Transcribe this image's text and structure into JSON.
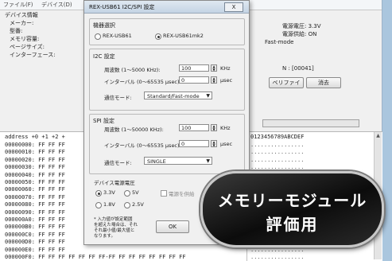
{
  "menubar": {
    "items": [
      "ファイル(F)",
      "デバイス(D)"
    ]
  },
  "device_info": {
    "heading": "デバイス情報",
    "rows": [
      "メーカー:",
      "型番:",
      "メモリ容量:",
      "ページサイズ:",
      "インターフェース:"
    ]
  },
  "right_info": {
    "voltage": "電源電圧: 3.3V",
    "power_supply": "電源供給: ON",
    "mode": "Fast-mode",
    "n_label": "N : [00041]"
  },
  "main_buttons": {
    "verify": "ベリファイ",
    "erase": "消去"
  },
  "dialog": {
    "title": "REX-USB61 I2C/SPI 設定",
    "close": "X",
    "model_group": {
      "title": "機器選択",
      "options": [
        "REX-USB61",
        "REX-USB61mk2"
      ],
      "selected": 1
    },
    "i2c_group": {
      "title": "I2C 設定",
      "freq_label": "周波数 (1〜5000 KHz):",
      "freq_value": "100",
      "freq_unit": "KHz",
      "interval_label": "インターバル (0〜65535 μsec):",
      "interval_value": "0",
      "interval_unit": "μsec",
      "mode_label": "通信モード:",
      "mode_value": "Standard/Fast-mode"
    },
    "spi_group": {
      "title": "SPI 設定",
      "freq_label": "周波数 (1〜50000 KHz):",
      "freq_value": "100",
      "freq_unit": "KHz",
      "interval_label": "インターバル (0〜65535 μsec):",
      "interval_value": "0",
      "interval_unit": "μsec",
      "mode_label": "通信モード:",
      "mode_value": "SINGLE"
    },
    "power_group": {
      "title": "デバイス電源電圧",
      "options": [
        "3.3V",
        "5V",
        "1.8V",
        "2.5V"
      ],
      "selected": 0,
      "supply_check": "電源を供給"
    },
    "note": [
      "* 入力値が設定範囲",
      "を超えた場合は、それ",
      "それ最小値/最大値と",
      "なります。"
    ],
    "ok_label": "OK"
  },
  "hex": {
    "header": "address  +0 +1 +2 +",
    "rows": [
      "00000000: FF FF FF",
      "00000010: FF FF FF",
      "00000020: FF FF FF",
      "00000030: FF FF FF",
      "00000040: FF FF FF",
      "00000050: FF FF FF",
      "00000060: FF FF FF",
      "00000070: FF FF FF",
      "00000080: FF FF FF",
      "00000090: FF FF FF",
      "000000A0: FF FF FF",
      "000000B0: FF FF FF",
      "000000C0: FF FF FF",
      "000000D0: FF FF FF",
      "000000E0: FF FF FF",
      "000000F0: FF FF FF FF FF FF FF-FF FF FF FF FF FF FF FF"
    ]
  },
  "ascii": {
    "header": "0123456789ABCDEF",
    "row": "................"
  },
  "badge": {
    "line1": "メモリーモジュール",
    "line2": "評価用"
  }
}
